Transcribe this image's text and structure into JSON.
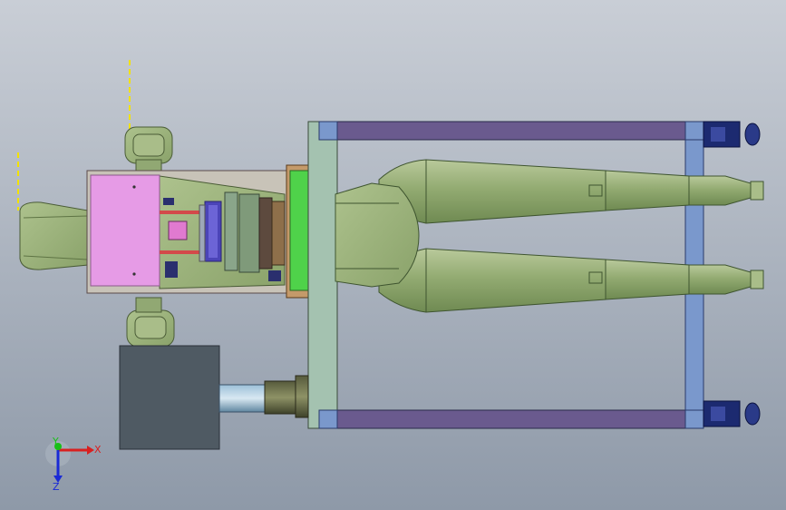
{
  "viewport": {
    "background_top": "#c9ced6",
    "background_bottom": "#8e99a8"
  },
  "colors": {
    "green_body": "#9fb482",
    "green_dark": "#6e8a52",
    "frame_purple": "#6a5a8e",
    "frame_blue": "#7a98cc",
    "pink_panel": "#e69be6",
    "bright_green_plate": "#4fd24a",
    "motor_box": "#4f5a63",
    "caster_navy": "#1c2a70"
  },
  "triad": {
    "x_label": "X",
    "y_label": "Y",
    "z_label": "Z",
    "icons": [
      "x-axis-arrow-icon",
      "y-axis-arrow-icon",
      "z-axis-arrow-icon"
    ]
  }
}
